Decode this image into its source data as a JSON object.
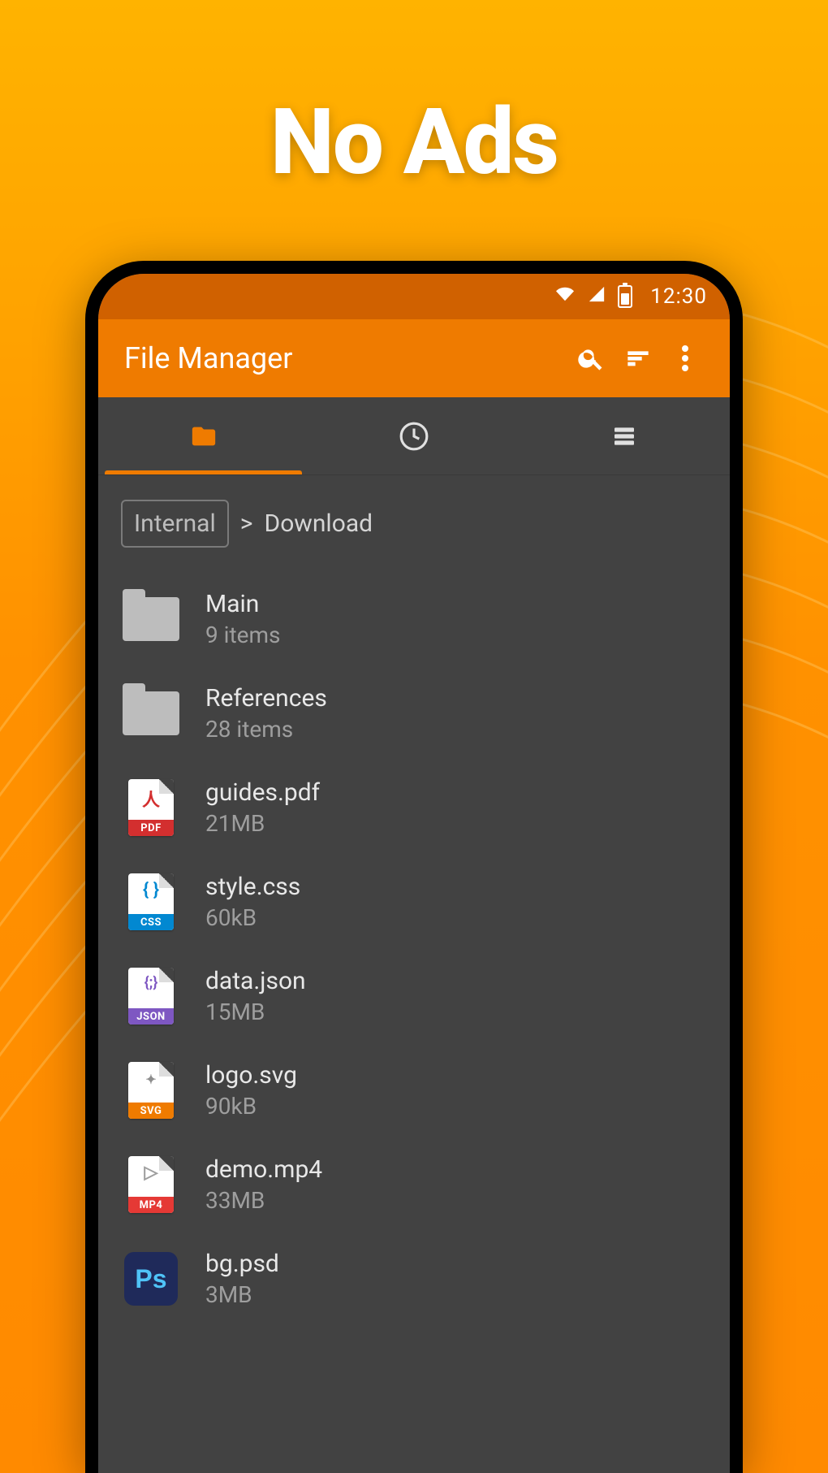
{
  "headline": "No Ads",
  "statusbar": {
    "time": "12:30"
  },
  "appbar": {
    "title": "File Manager"
  },
  "tabs": {
    "active_index": 0,
    "items": [
      {
        "id": "folder",
        "label": "Files"
      },
      {
        "id": "recent",
        "label": "Recent"
      },
      {
        "id": "storage",
        "label": "Storage"
      }
    ]
  },
  "breadcrumb": {
    "root": "Internal",
    "separator": ">",
    "current": "Download"
  },
  "files": [
    {
      "type": "folder",
      "name": "Main",
      "meta": "9 items"
    },
    {
      "type": "folder",
      "name": "References",
      "meta": "28 items"
    },
    {
      "type": "pdf",
      "name": "guides.pdf",
      "meta": "21MB",
      "badge": "PDF",
      "glyph": "人"
    },
    {
      "type": "css",
      "name": "style.css",
      "meta": "60kB",
      "badge": "CSS",
      "glyph": "{ }"
    },
    {
      "type": "json",
      "name": "data.json",
      "meta": "15MB",
      "badge": "JSON",
      "glyph": "{;}"
    },
    {
      "type": "svg",
      "name": "logo.svg",
      "meta": "90kB",
      "badge": "SVG",
      "glyph": "✦"
    },
    {
      "type": "mp4",
      "name": "demo.mp4",
      "meta": "33MB",
      "badge": "MP4",
      "glyph": "▷"
    },
    {
      "type": "psd",
      "name": "bg.psd",
      "meta": "3MB",
      "glyph": "Ps"
    }
  ],
  "colors": {
    "accent": "#ef7b00",
    "appbar": "#ef7b00",
    "statusbar": "#d06100",
    "surface": "#424242"
  }
}
